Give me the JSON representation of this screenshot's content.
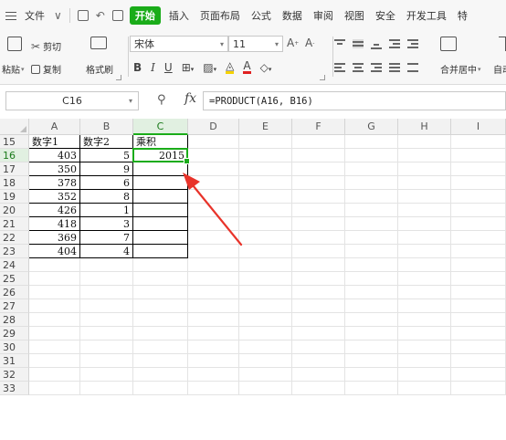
{
  "menubar": {
    "items": [
      {
        "label": "文件",
        "active": false
      },
      {
        "label": "开始",
        "active": true
      },
      {
        "label": "插入",
        "active": false
      },
      {
        "label": "页面布局",
        "active": false
      },
      {
        "label": "公式",
        "active": false
      },
      {
        "label": "数据",
        "active": false
      },
      {
        "label": "审阅",
        "active": false
      },
      {
        "label": "视图",
        "active": false
      },
      {
        "label": "安全",
        "active": false
      },
      {
        "label": "开发工具",
        "active": false
      },
      {
        "label": "特",
        "active": false
      }
    ]
  },
  "ribbon": {
    "cut_label": "剪切",
    "paste_label": "粘贴",
    "copy_label": "复制",
    "format_painter_label": "格式刷",
    "font_name": "宋体",
    "font_size": "11",
    "merge_label": "合并居中",
    "autowrap_label": "自动"
  },
  "formula_bar": {
    "cell_ref": "C16",
    "fx_label": "fx",
    "formula": "=PRODUCT(A16, B16)"
  },
  "sheet": {
    "columns": [
      "A",
      "B",
      "C",
      "D",
      "E",
      "F",
      "G",
      "H",
      "I"
    ],
    "selected_column": "C",
    "selected_row": "16",
    "rows": [
      {
        "num": "15",
        "cells": [
          "数字1",
          "数字2",
          "乘积"
        ]
      },
      {
        "num": "16",
        "cells": [
          "403",
          "5",
          "2015"
        ]
      },
      {
        "num": "17",
        "cells": [
          "350",
          "9",
          ""
        ]
      },
      {
        "num": "18",
        "cells": [
          "378",
          "6",
          ""
        ]
      },
      {
        "num": "19",
        "cells": [
          "352",
          "8",
          ""
        ]
      },
      {
        "num": "20",
        "cells": [
          "426",
          "1",
          ""
        ]
      },
      {
        "num": "21",
        "cells": [
          "418",
          "3",
          ""
        ]
      },
      {
        "num": "22",
        "cells": [
          "369",
          "7",
          ""
        ]
      },
      {
        "num": "23",
        "cells": [
          "404",
          "4",
          ""
        ]
      },
      {
        "num": "24",
        "cells": [
          "",
          "",
          ""
        ]
      },
      {
        "num": "25",
        "cells": [
          "",
          "",
          ""
        ]
      },
      {
        "num": "26",
        "cells": [
          "",
          "",
          ""
        ]
      },
      {
        "num": "27",
        "cells": [
          "",
          "",
          ""
        ]
      },
      {
        "num": "28",
        "cells": [
          "",
          "",
          ""
        ]
      },
      {
        "num": "29",
        "cells": [
          "",
          "",
          ""
        ]
      },
      {
        "num": "30",
        "cells": [
          "",
          "",
          ""
        ]
      },
      {
        "num": "31",
        "cells": [
          "",
          "",
          ""
        ]
      },
      {
        "num": "32",
        "cells": [
          "",
          "",
          ""
        ]
      },
      {
        "num": "33",
        "cells": [
          "",
          "",
          ""
        ]
      }
    ]
  },
  "colors": {
    "accent": "#1aac19",
    "arrow": "#e8332a"
  }
}
